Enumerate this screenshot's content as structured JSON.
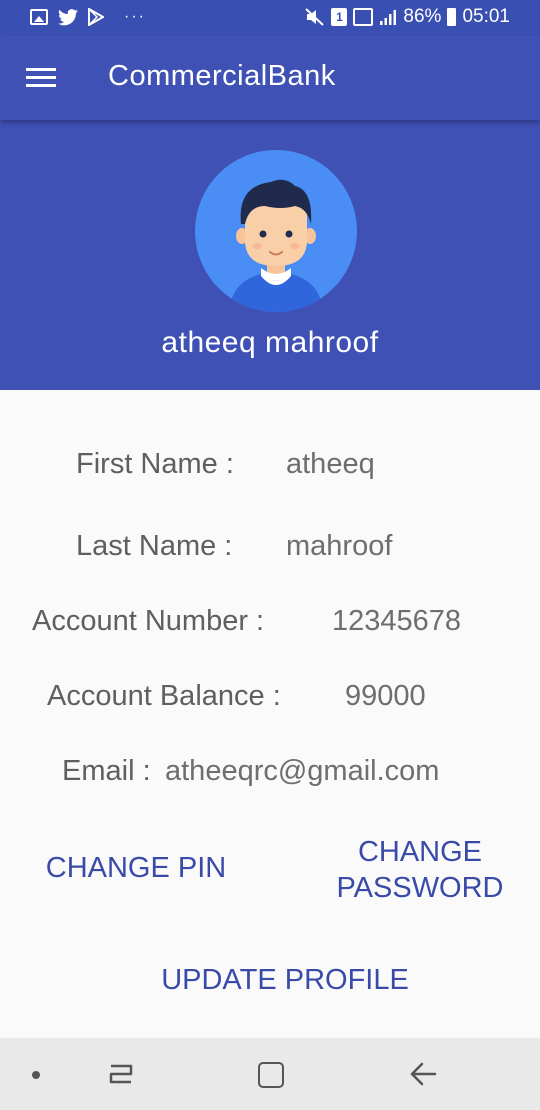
{
  "status_bar": {
    "battery_percent": "86%",
    "time": "05:01",
    "sim_badge": "1",
    "more_dots": "···",
    "icons": [
      "gallery-icon",
      "twitter-icon",
      "play-store-icon",
      "mute-icon",
      "signal-icon",
      "battery-icon"
    ]
  },
  "app_bar": {
    "title": "CommercialBank",
    "menu_icon": "hamburger-menu-icon"
  },
  "profile": {
    "name": "atheeq mahroof",
    "avatar_icon": "user-avatar-icon"
  },
  "details": {
    "first_name_label": "First Name :",
    "first_name_value": "atheeq",
    "last_name_label": "Last Name :",
    "last_name_value": "mahroof",
    "account_number_label": "Account Number :",
    "account_number_value": "12345678",
    "account_balance_label": "Account Balance :",
    "account_balance_value": "99000",
    "email_label": "Email :",
    "email_value": "atheeqrc@gmail.com"
  },
  "actions": {
    "change_pin": "CHANGE PIN",
    "change_password_line1": "CHANGE",
    "change_password_line2": "PASSWORD",
    "update_profile": "UPDATE PROFILE"
  },
  "colors": {
    "primary": "#3f51b5",
    "status_bar": "#3a4fb2",
    "button_text": "#3a4aa8",
    "background": "#fafafa"
  }
}
